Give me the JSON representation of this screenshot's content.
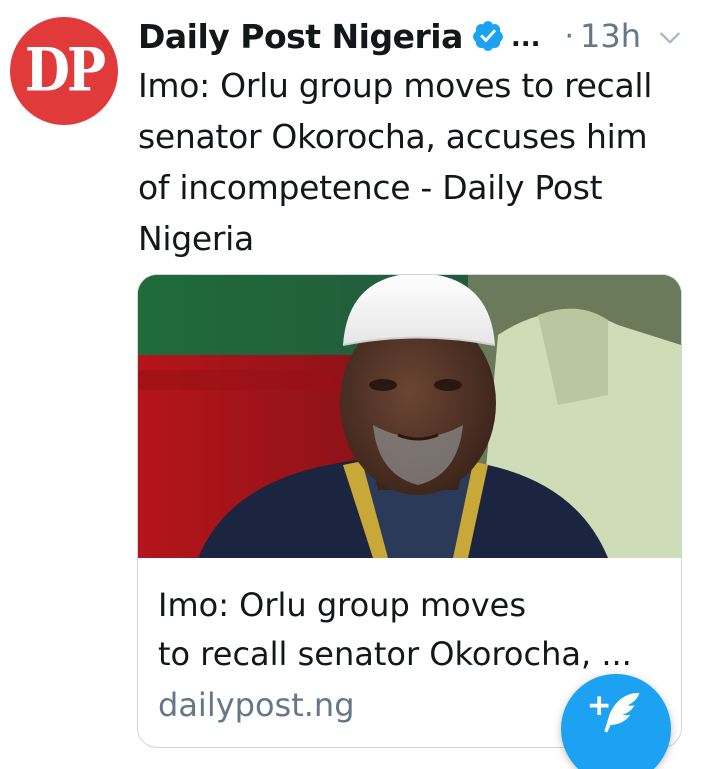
{
  "tweet": {
    "avatar": {
      "text": "DP",
      "color": "#e13a3a"
    },
    "author_name": "Daily Post Nigeria",
    "verified": true,
    "name_ellipsis": "...",
    "dot": "·",
    "timestamp": "13h",
    "text_lines": [
      "Imo: Orlu group moves to recall",
      "senator Okorocha, accuses him",
      "of incompetence - Daily Post",
      "Nigeria"
    ],
    "card": {
      "image_icon": "photo-of-man-in-white-cap",
      "title_lines": [
        "Imo: Orlu group moves",
        "to recall senator Okorocha, ..."
      ],
      "domain": "dailypost.ng"
    }
  },
  "compose_button": {
    "icon": "compose-feather-plus-icon",
    "color": "#1da1f2"
  },
  "colors": {
    "text_primary": "#14171a",
    "text_secondary": "#657786",
    "accent": "#1da1f2",
    "card_border": "#ccd6dd"
  }
}
